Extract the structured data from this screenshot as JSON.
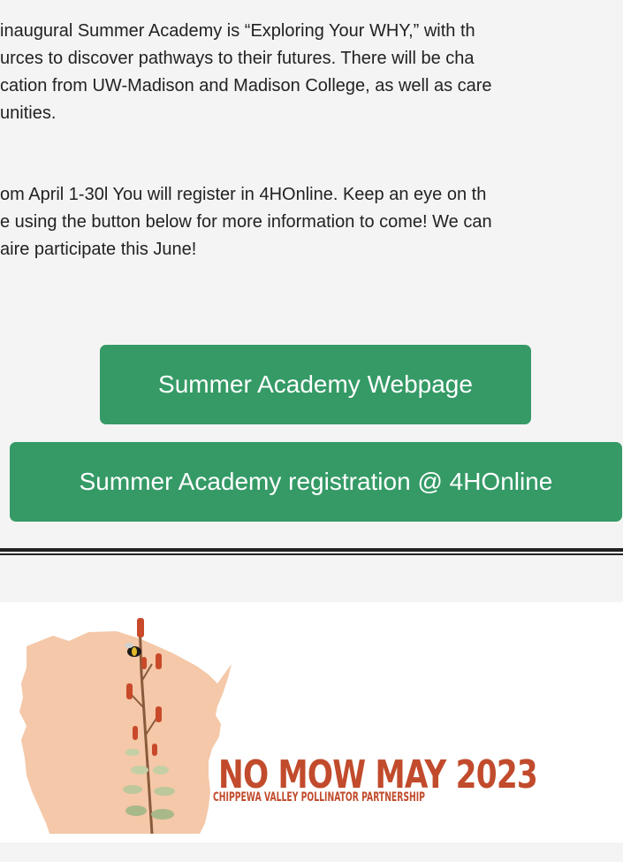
{
  "intro": {
    "lines": [
      " inaugural Summer Academy is “Exploring Your WHY,” with th",
      "urces to discover pathways to their futures. There will be cha",
      "cation from UW-Madison and Madison College, as well as care",
      "unities."
    ]
  },
  "registration": {
    "lines": [
      "om April 1-30l You will register in 4HOnline. Keep an eye on th",
      "e using the button below for more information to come! We can",
      "aire participate this June!"
    ]
  },
  "buttons": {
    "webpage_label": "Summer Academy Webpage",
    "register_label": "Summer Academy registration @ 4HOnline"
  },
  "banner": {
    "title": "NO MOW MAY 2023",
    "subtitle": "CHIPPEWA VALLEY POLLINATOR PARTNERSHIP",
    "icons": [
      "wisconsin-map-icon",
      "wildflower-icon",
      "bumblebee-icon"
    ]
  },
  "colors": {
    "button": "#359a66",
    "banner_text": "#c14b2c",
    "map": "#f4c8a8"
  }
}
